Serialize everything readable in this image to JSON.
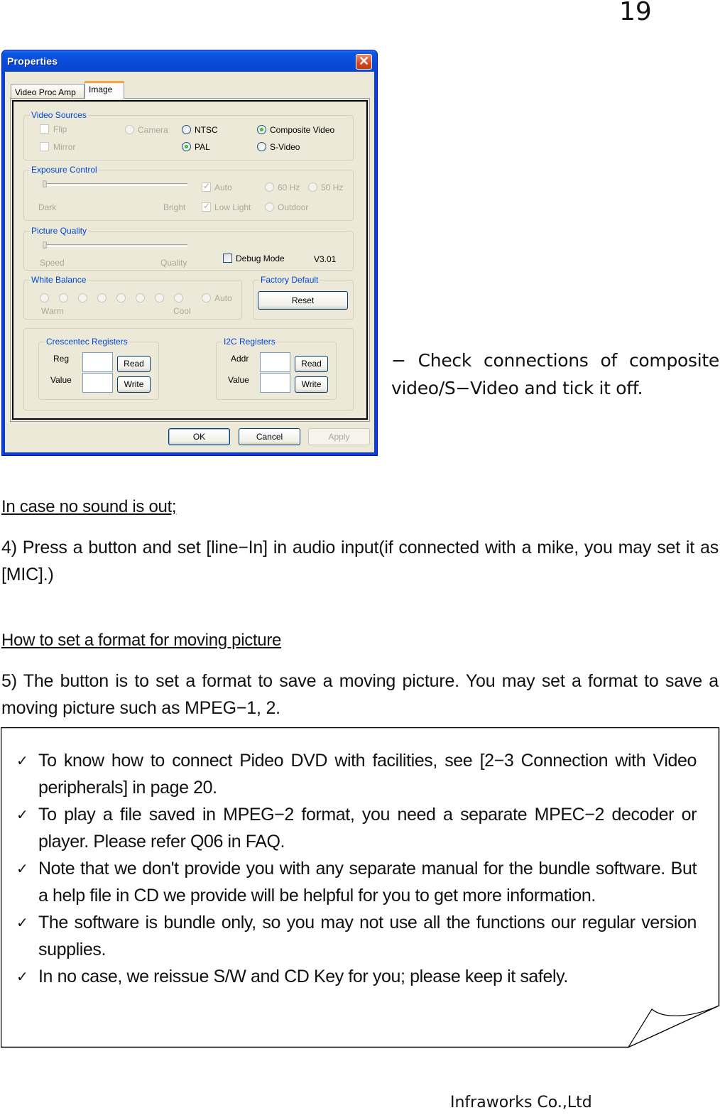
{
  "page_number": "19",
  "dialog": {
    "title": "Properties",
    "close_icon": "close-icon",
    "tabs": [
      {
        "label": "Video Proc Amp",
        "active": false
      },
      {
        "label": "Image",
        "active": true
      }
    ],
    "video_sources": {
      "label": "Video Sources",
      "flip": {
        "label": "Flip",
        "checked": false,
        "enabled": false
      },
      "mirror": {
        "label": "Mirror",
        "checked": false,
        "enabled": false
      },
      "camera": {
        "label": "Camera",
        "selected": false,
        "enabled": false
      },
      "ntsc": {
        "label": "NTSC",
        "selected": false
      },
      "pal": {
        "label": "PAL",
        "selected": true
      },
      "composite": {
        "label": "Composite Video",
        "selected": true
      },
      "svideo": {
        "label": "S-Video",
        "selected": false
      }
    },
    "exposure_control": {
      "label": "Exposure Control",
      "slider_min_label": "Dark",
      "slider_max_label": "Bright",
      "slider_value": 0,
      "auto": {
        "label": "Auto",
        "checked": true,
        "enabled": false
      },
      "low_light": {
        "label": "Low Light",
        "checked": true,
        "enabled": false
      },
      "hz60": {
        "label": "60 Hz",
        "enabled": false
      },
      "hz50": {
        "label": "50 Hz",
        "enabled": false
      },
      "outdoor": {
        "label": "Outdoor",
        "enabled": false
      }
    },
    "picture_quality": {
      "label": "Picture Quality",
      "slider_min_label": "Speed",
      "slider_max_label": "Quality",
      "slider_value": 0,
      "debug_mode": {
        "label": "Debug Mode",
        "checked": false
      },
      "version": "V3.01"
    },
    "white_balance": {
      "label": "White Balance",
      "levels": 8,
      "warm_label": "Warm",
      "cool_label": "Cool",
      "auto_label": "Auto"
    },
    "factory_default": {
      "label": "Factory Default",
      "reset_label": "Reset"
    },
    "crescentec": {
      "label": "Crescentec Registers",
      "reg_label": "Reg",
      "value_label": "Value",
      "reg_value": "",
      "value_value": "",
      "read_label": "Read",
      "write_label": "Write"
    },
    "i2c": {
      "label": "I2C Registers",
      "addr_label": "Addr",
      "value_label": "Value",
      "addr_value": "",
      "value_value": "",
      "read_label": "Read",
      "write_label": "Write"
    },
    "buttons": {
      "ok": "OK",
      "cancel": "Cancel",
      "apply": "Apply"
    }
  },
  "side_note": "− Check connections of composite video/S−Video and tick it off.",
  "sections": [
    {
      "heading": "In case no sound is out;",
      "body": "4) Press a button and set [line−In] in audio input(if connected with a mike, you may set it as [MIC].)"
    },
    {
      "heading": "How to set a format for moving picture",
      "body": "5) The button is to set a format to save a moving picture. You may set a format to save a moving picture such as MPEG−1, 2."
    }
  ],
  "notes": [
    "To know how to connect Pideo DVD with facilities, see [2−3 Connection with Video peripherals] in page 20.",
    "To play a file saved in MPEG−2 format, you need a separate MPEC−2 decoder or player. Please refer Q06 in FAQ.",
    "Note that we don't provide you with any separate manual for the bundle software. But a help file in CD we provide will be helpful for you to get more information.",
    "The software is bundle only, so you may not use all the functions our regular version supplies.",
    "In no case, we reissue S/W and CD Key for you; please keep it safely."
  ],
  "check_glyph": "✓",
  "footer": "Infraworks Co.,Ltd"
}
